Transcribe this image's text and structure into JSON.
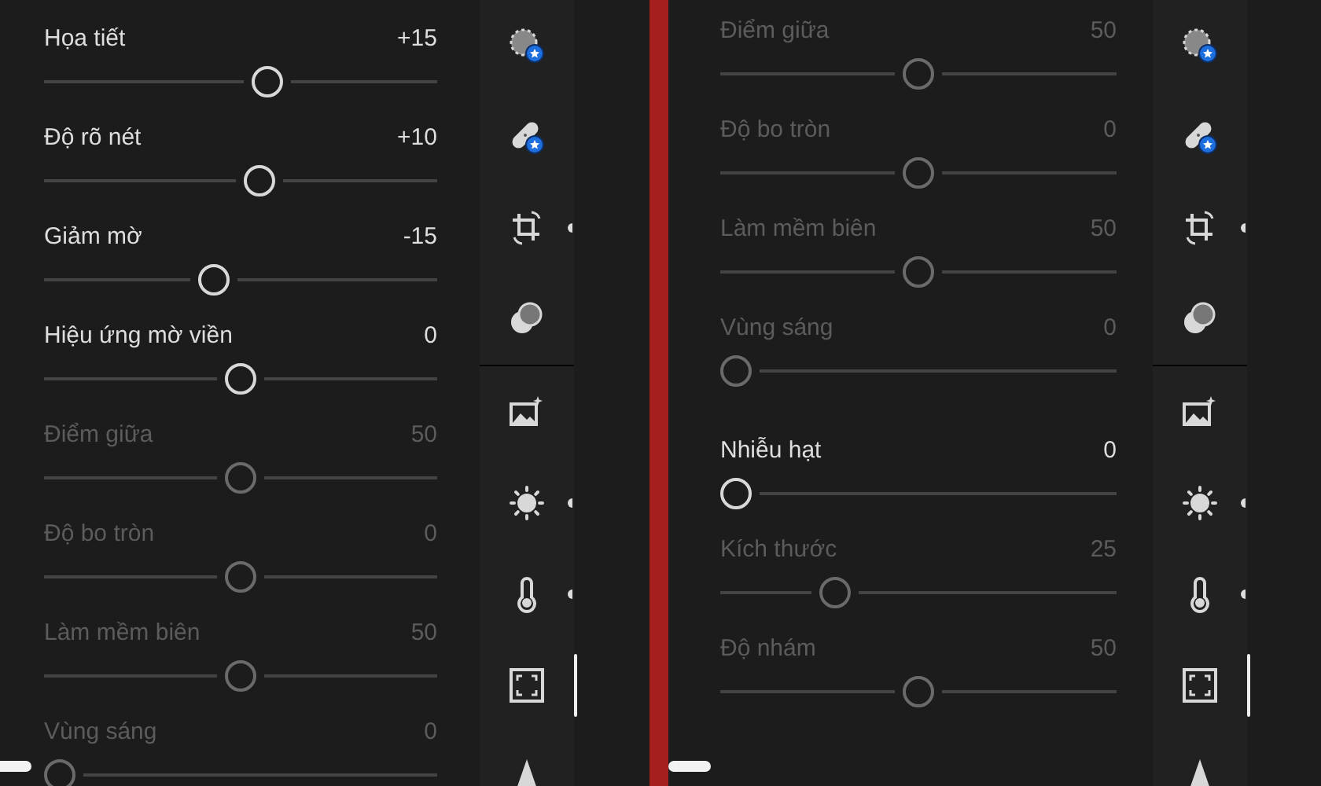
{
  "panels": [
    {
      "slider_groups": [
        [
          {
            "label": "Họa tiết",
            "value": "+15",
            "level": 0.575,
            "disabled": false
          },
          {
            "label": "Độ rõ nét",
            "value": "+10",
            "level": 0.55,
            "disabled": false
          },
          {
            "label": "Giảm mờ",
            "value": "-15",
            "level": 0.425,
            "disabled": false
          },
          {
            "label": "Hiệu ứng mờ viền",
            "value": "0",
            "level": 0.5,
            "disabled": false
          },
          {
            "label": "Điểm giữa",
            "value": "50",
            "level": 0.5,
            "disabled": true
          },
          {
            "label": "Độ bo tròn",
            "value": "0",
            "level": 0.5,
            "disabled": true
          },
          {
            "label": "Làm mềm biên",
            "value": "50",
            "level": 0.5,
            "disabled": true
          },
          {
            "label": "Vùng sáng",
            "value": "0",
            "level": 0,
            "disabled": true
          }
        ]
      ],
      "tool_groups": [
        [
          {
            "kind": "selective",
            "selected": false,
            "expandable": false
          },
          {
            "kind": "healing",
            "selected": false,
            "expandable": false
          },
          {
            "kind": "crop",
            "selected": false,
            "expandable": true
          },
          {
            "kind": "masking",
            "selected": false,
            "expandable": false
          }
        ],
        [
          {
            "kind": "presets",
            "selected": false,
            "expandable": false
          },
          {
            "kind": "light",
            "selected": false,
            "expandable": true
          },
          {
            "kind": "color",
            "selected": false,
            "expandable": true
          },
          {
            "kind": "effects",
            "selected": true,
            "expandable": false
          },
          {
            "kind": "detail",
            "selected": false,
            "expandable": false
          }
        ]
      ]
    },
    {
      "slider_groups": [
        [
          {
            "label": "Điểm giữa",
            "value": "50",
            "level": 0.5,
            "disabled": true
          },
          {
            "label": "Độ bo tròn",
            "value": "0",
            "level": 0.5,
            "disabled": true
          },
          {
            "label": "Làm mềm biên",
            "value": "50",
            "level": 0.5,
            "disabled": true
          },
          {
            "label": "Vùng sáng",
            "value": "0",
            "level": 0,
            "disabled": true
          }
        ],
        [
          {
            "label": "Nhiễu hạt",
            "value": "0",
            "level": 0,
            "disabled": false
          },
          {
            "label": "Kích thước",
            "value": "25",
            "level": 0.27,
            "disabled": true
          },
          {
            "label": "Độ nhám",
            "value": "50",
            "level": 0.5,
            "disabled": true
          }
        ]
      ],
      "tool_groups": [
        [
          {
            "kind": "selective",
            "selected": false,
            "expandable": false
          },
          {
            "kind": "healing",
            "selected": false,
            "expandable": false
          },
          {
            "kind": "crop",
            "selected": false,
            "expandable": true
          },
          {
            "kind": "masking",
            "selected": false,
            "expandable": false
          }
        ],
        [
          {
            "kind": "presets",
            "selected": false,
            "expandable": false
          },
          {
            "kind": "light",
            "selected": false,
            "expandable": true
          },
          {
            "kind": "color",
            "selected": false,
            "expandable": true
          },
          {
            "kind": "effects",
            "selected": true,
            "expandable": false
          },
          {
            "kind": "detail",
            "selected": false,
            "expandable": false
          }
        ]
      ]
    }
  ]
}
